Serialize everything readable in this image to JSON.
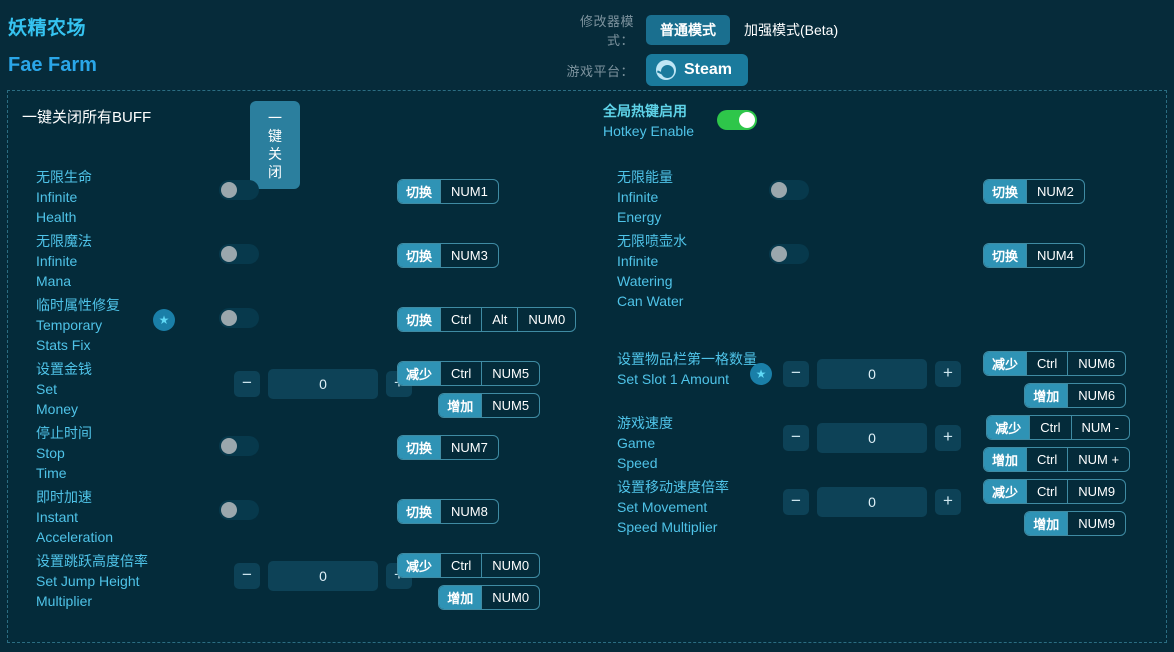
{
  "header": {
    "title_cn": "妖精农场",
    "title_en": "Fae Farm",
    "mode_label": "修改器模式：",
    "mode_normal": "普通模式",
    "mode_enhanced": "加强模式(Beta)",
    "platform_label": "游戏平台：",
    "platform_value": "Steam",
    "steam_icon": "steam-icon"
  },
  "top": {
    "close_all_cn": "一键关闭所有BUFF",
    "close_all_btn": "一键关闭",
    "hotkey_cn": "全局热键启用",
    "hotkey_en": "Hotkey Enable",
    "hotkey_on": true
  },
  "left_rows": [
    {
      "cn": "无限生命",
      "en": "Infinite Health",
      "type": "toggle",
      "on": false,
      "star": false,
      "hotkeys": [
        {
          "action": "切换",
          "keys": [
            "NUM1"
          ]
        }
      ]
    },
    {
      "cn": "无限魔法",
      "en": "Infinite Mana",
      "type": "toggle",
      "on": false,
      "star": false,
      "hotkeys": [
        {
          "action": "切换",
          "keys": [
            "NUM3"
          ]
        }
      ]
    },
    {
      "cn": "临时属性修复",
      "en": "Temporary Stats Fix",
      "type": "toggle",
      "on": false,
      "star": true,
      "hotkeys": [
        {
          "action": "切换",
          "keys": [
            "Ctrl",
            "Alt",
            "NUM0"
          ]
        }
      ]
    },
    {
      "cn": "设置金钱",
      "en": "Set Money",
      "type": "stepper",
      "value": "0",
      "star": false,
      "minus": "−",
      "plus": "+",
      "hotkeys": [
        {
          "action": "减少",
          "keys": [
            "Ctrl",
            "NUM5"
          ]
        },
        {
          "action": "增加",
          "keys": [
            "NUM5"
          ]
        }
      ]
    },
    {
      "cn": "停止时间",
      "en": "Stop Time",
      "type": "toggle",
      "on": false,
      "star": false,
      "hotkeys": [
        {
          "action": "切换",
          "keys": [
            "NUM7"
          ]
        }
      ]
    },
    {
      "cn": "即时加速",
      "en": "Instant Acceleration",
      "type": "toggle",
      "on": false,
      "star": false,
      "hotkeys": [
        {
          "action": "切换",
          "keys": [
            "NUM8"
          ]
        }
      ]
    },
    {
      "cn": "设置跳跃高度倍率",
      "en": "Set Jump Height Multiplier",
      "type": "stepper",
      "value": "0",
      "star": false,
      "minus": "−",
      "plus": "+",
      "hotkeys": [
        {
          "action": "减少",
          "keys": [
            "Ctrl",
            "NUM0"
          ]
        },
        {
          "action": "增加",
          "keys": [
            "NUM0"
          ]
        }
      ]
    }
  ],
  "right_rows": [
    {
      "cn": "无限能量",
      "en": "Infinite Energy",
      "type": "toggle",
      "on": false,
      "star": false,
      "hotkeys": [
        {
          "action": "切换",
          "keys": [
            "NUM2"
          ]
        }
      ]
    },
    {
      "cn": "无限喷壶水",
      "en": "Infinite Watering Can Water",
      "type": "toggle",
      "on": false,
      "star": false,
      "hotkeys": [
        {
          "action": "切换",
          "keys": [
            "NUM4"
          ]
        }
      ]
    },
    {
      "cn": "设置物品栏第一格数量",
      "en": "Set Slot 1 Amount",
      "type": "stepper",
      "value": "0",
      "star": true,
      "minus": "−",
      "plus": "+",
      "hotkeys": [
        {
          "action": "减少",
          "keys": [
            "Ctrl",
            "NUM6"
          ]
        },
        {
          "action": "增加",
          "keys": [
            "NUM6"
          ]
        }
      ]
    },
    {
      "cn": "游戏速度",
      "en": "Game Speed",
      "type": "stepper",
      "value": "0",
      "star": false,
      "minus": "−",
      "plus": "+",
      "hotkeys": [
        {
          "action": "减少",
          "keys": [
            "Ctrl",
            "NUM -"
          ]
        },
        {
          "action": "增加",
          "keys": [
            "Ctrl",
            "NUM +"
          ]
        }
      ]
    },
    {
      "cn": "设置移动速度倍率",
      "en": "Set Movement Speed Multiplier",
      "type": "stepper",
      "value": "0",
      "star": false,
      "minus": "−",
      "plus": "+",
      "hotkeys": [
        {
          "action": "减少",
          "keys": [
            "Ctrl",
            "NUM9"
          ]
        },
        {
          "action": "增加",
          "keys": [
            "NUM9"
          ]
        }
      ]
    }
  ],
  "colors": {
    "page_bg": "#062b3a",
    "panel_bg": "#042b3a",
    "accent": "#2f93b5",
    "label": "#4fc3e8",
    "toggle_on": "#2ec64a"
  }
}
